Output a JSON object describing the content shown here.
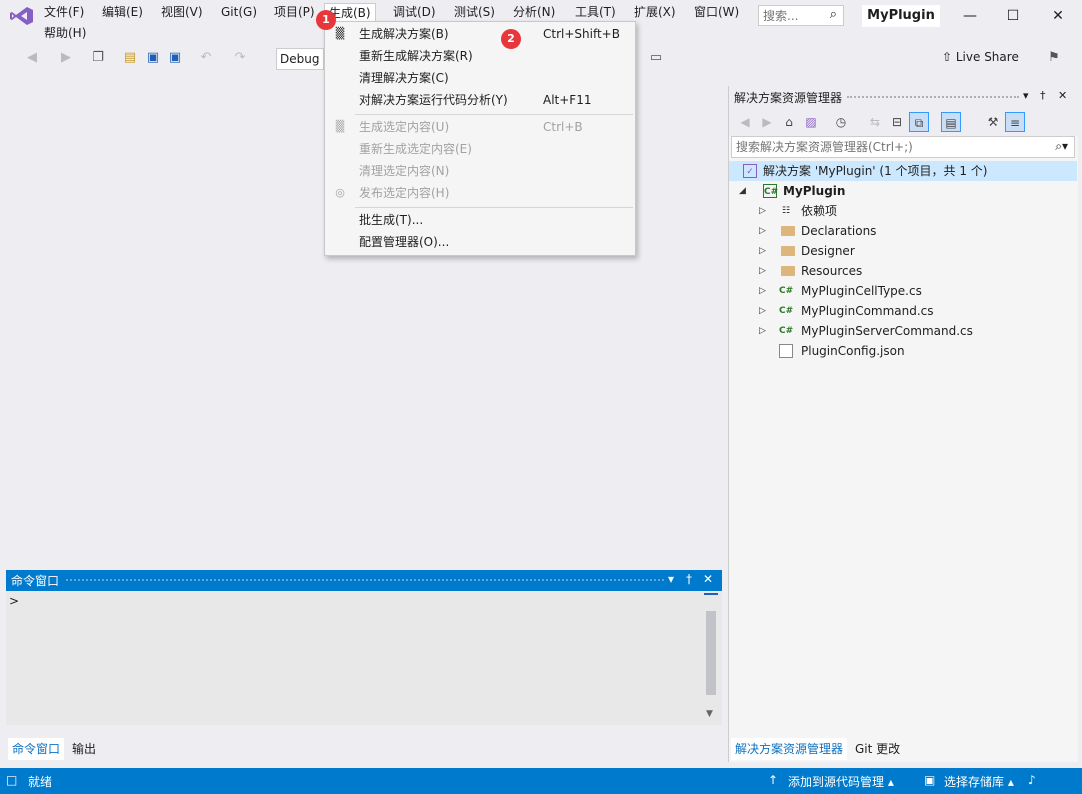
{
  "menubar": {
    "items": [
      "文件(F)",
      "编辑(E)",
      "视图(V)",
      "Git(G)",
      "项目(P)",
      "生成(B)",
      "调试(D)",
      "测试(S)",
      "分析(N)",
      "工具(T)",
      "扩展(X)",
      "窗口(W)",
      "帮助(H)"
    ],
    "search_placeholder": "搜索...",
    "project_name": "MyPlugin"
  },
  "toolbar": {
    "config": "Debug",
    "live_share": "Live Share"
  },
  "build_menu": {
    "items": [
      {
        "label": "生成解决方案(B)",
        "shortcut": "Ctrl+Shift+B",
        "enabled": true,
        "icon": "build-icon"
      },
      {
        "label": "重新生成解决方案(R)",
        "shortcut": "",
        "enabled": true
      },
      {
        "label": "清理解决方案(C)",
        "shortcut": "",
        "enabled": true
      },
      {
        "label": "对解决方案运行代码分析(Y)",
        "shortcut": "Alt+F11",
        "enabled": true
      },
      {
        "label": "生成选定内容(U)",
        "shortcut": "Ctrl+B",
        "enabled": false,
        "icon": "build-icon"
      },
      {
        "label": "重新生成选定内容(E)",
        "shortcut": "",
        "enabled": false
      },
      {
        "label": "清理选定内容(N)",
        "shortcut": "",
        "enabled": false
      },
      {
        "label": "发布选定内容(H)",
        "shortcut": "",
        "enabled": false,
        "icon": "globe-icon"
      },
      {
        "label": "批生成(T)...",
        "shortcut": "",
        "enabled": true
      },
      {
        "label": "配置管理器(O)...",
        "shortcut": "",
        "enabled": true
      }
    ]
  },
  "badges": {
    "one": "1",
    "two": "2"
  },
  "command_window": {
    "title": "命令窗口",
    "prompt": ">",
    "tabs": [
      "命令窗口",
      "输出"
    ]
  },
  "solution_explorer": {
    "title": "解决方案资源管理器",
    "search_placeholder": "搜索解决方案资源管理器(Ctrl+;)",
    "solution_label": "解决方案 'MyPlugin' (1 个项目，共 1 个)",
    "project": "MyPlugin",
    "children": [
      "依赖项",
      "Declarations",
      "Designer",
      "Resources",
      "MyPluginCellType.cs",
      "MyPluginCommand.cs",
      "MyPluginServerCommand.cs",
      "PluginConfig.json"
    ],
    "tabs": [
      "解决方案资源管理器",
      "Git 更改"
    ]
  },
  "statusbar": {
    "status": "就绪",
    "add_source": "添加到源代码管理",
    "select_repo": "选择存储库"
  },
  "colors": {
    "accent": "#007acc",
    "badge": "#e8363a",
    "folder": "#dcb67a"
  }
}
